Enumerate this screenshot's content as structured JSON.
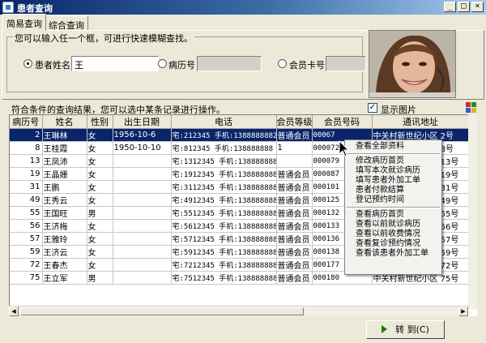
{
  "window": {
    "title": "患者查询",
    "minimize": "_",
    "maximize": "□",
    "close": "×"
  },
  "tabs": [
    {
      "label": "简易查询",
      "active": true
    },
    {
      "label": "综合查询",
      "active": false
    }
  ],
  "search": {
    "legend": "您可以输入任一个框，可进行快速模糊查找。",
    "patient_name": {
      "label": "患者姓名",
      "value": "王",
      "checked": true
    },
    "record_no": {
      "label": "病历号",
      "value": "",
      "checked": false
    },
    "member_card": {
      "label": "会员卡号",
      "value": "",
      "checked": false
    }
  },
  "results": {
    "note": "符合条件的查询结果，您可以选中某条记录进行操作。",
    "show_photo_label": "显示图片",
    "show_photo_checked": true
  },
  "table": {
    "columns": [
      "病历号",
      "姓名",
      "性别",
      "出生日期",
      "电话",
      "会员等级",
      "会员号码",
      "通讯地址"
    ],
    "rows": [
      [
        "2",
        "王琳林",
        "女",
        "1956-10-6",
        "宅:212345 手机:1388888882",
        "普通会员",
        "00067",
        "中关村新世纪小区 2号"
      ],
      [
        "8",
        "王桂霞",
        "女",
        "1950-10-10",
        "宅:812345 手机:138888888",
        "1",
        "000072",
        "中关村新世纪小区 8号"
      ],
      [
        "13",
        "王凤沛",
        "女",
        "",
        "宅:1312345 手机:138888888",
        "",
        "000079",
        "中关村新世纪小区 13号"
      ],
      [
        "19",
        "王晶姗",
        "女",
        "",
        "宅:1912345 手机:138888888",
        "普通会员",
        "000087",
        "中关村新世纪小区 19号"
      ],
      [
        "31",
        "王鹏",
        "女",
        "",
        "宅:3112345 手机:138888888",
        "普通会员",
        "000101",
        "中关村新世纪小区 31号"
      ],
      [
        "49",
        "王秀云",
        "女",
        "",
        "宅:4912345 手机:138888888",
        "普通会员",
        "000125",
        "中关村新世纪小区 49号"
      ],
      [
        "55",
        "王国旺",
        "男",
        "",
        "宅:5512345 手机:138888888",
        "普通会员",
        "000132",
        "中关村新世纪小区 55号"
      ],
      [
        "56",
        "王济梅",
        "女",
        "",
        "宅:5612345 手机:138888888",
        "普通会员",
        "000133",
        "中关村新世纪小区 56号"
      ],
      [
        "57",
        "王雅玲",
        "女",
        "",
        "宅:5712345 手机:138888888",
        "普通会员",
        "000136",
        "中关村新世纪小区 57号"
      ],
      [
        "59",
        "王济云",
        "女",
        "",
        "宅:5912345 手机:138888888",
        "普通会员",
        "000138",
        "中关村新世纪小区 59号"
      ],
      [
        "72",
        "王春杰",
        "女",
        "",
        "宅:7212345 手机:138888888",
        "普通会员",
        "000177",
        "中关村新世纪小区 72号"
      ],
      [
        "75",
        "王立军",
        "男",
        "",
        "宅:7512345 手机:138888888",
        "普通会员",
        "000180",
        "中关村新世纪小区 75号"
      ]
    ],
    "selected_row": 0
  },
  "context_menu": {
    "groups": [
      [
        "查看全部资料"
      ],
      [
        "修改病历首页",
        "填写本次就诊病历",
        "填写患者外加工单",
        "患者付款结算",
        "登记预约时间"
      ],
      [
        "查看病历首页",
        "查看以前就诊病历",
        "查看以前收费情况",
        "查看复诊预约情况",
        "查看该患者外加工单"
      ]
    ]
  },
  "buttons": {
    "goto": "转 到(C)"
  },
  "colors": {
    "title_bar": "#0a246a",
    "selection": "#0a246a",
    "window_bg": "#ece9d8",
    "go_arrow": "#108010"
  }
}
